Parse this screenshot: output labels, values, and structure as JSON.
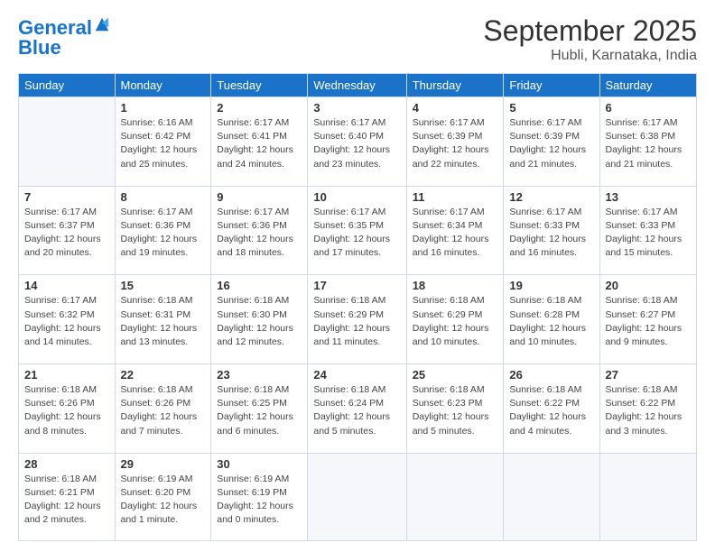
{
  "header": {
    "logo_line1": "General",
    "logo_line2": "Blue",
    "month": "September 2025",
    "location": "Hubli, Karnataka, India"
  },
  "weekdays": [
    "Sunday",
    "Monday",
    "Tuesday",
    "Wednesday",
    "Thursday",
    "Friday",
    "Saturday"
  ],
  "weeks": [
    [
      {
        "day": "",
        "info": ""
      },
      {
        "day": "1",
        "info": "Sunrise: 6:16 AM\nSunset: 6:42 PM\nDaylight: 12 hours\nand 25 minutes."
      },
      {
        "day": "2",
        "info": "Sunrise: 6:17 AM\nSunset: 6:41 PM\nDaylight: 12 hours\nand 24 minutes."
      },
      {
        "day": "3",
        "info": "Sunrise: 6:17 AM\nSunset: 6:40 PM\nDaylight: 12 hours\nand 23 minutes."
      },
      {
        "day": "4",
        "info": "Sunrise: 6:17 AM\nSunset: 6:39 PM\nDaylight: 12 hours\nand 22 minutes."
      },
      {
        "day": "5",
        "info": "Sunrise: 6:17 AM\nSunset: 6:39 PM\nDaylight: 12 hours\nand 21 minutes."
      },
      {
        "day": "6",
        "info": "Sunrise: 6:17 AM\nSunset: 6:38 PM\nDaylight: 12 hours\nand 21 minutes."
      }
    ],
    [
      {
        "day": "7",
        "info": "Sunrise: 6:17 AM\nSunset: 6:37 PM\nDaylight: 12 hours\nand 20 minutes."
      },
      {
        "day": "8",
        "info": "Sunrise: 6:17 AM\nSunset: 6:36 PM\nDaylight: 12 hours\nand 19 minutes."
      },
      {
        "day": "9",
        "info": "Sunrise: 6:17 AM\nSunset: 6:36 PM\nDaylight: 12 hours\nand 18 minutes."
      },
      {
        "day": "10",
        "info": "Sunrise: 6:17 AM\nSunset: 6:35 PM\nDaylight: 12 hours\nand 17 minutes."
      },
      {
        "day": "11",
        "info": "Sunrise: 6:17 AM\nSunset: 6:34 PM\nDaylight: 12 hours\nand 16 minutes."
      },
      {
        "day": "12",
        "info": "Sunrise: 6:17 AM\nSunset: 6:33 PM\nDaylight: 12 hours\nand 16 minutes."
      },
      {
        "day": "13",
        "info": "Sunrise: 6:17 AM\nSunset: 6:33 PM\nDaylight: 12 hours\nand 15 minutes."
      }
    ],
    [
      {
        "day": "14",
        "info": "Sunrise: 6:17 AM\nSunset: 6:32 PM\nDaylight: 12 hours\nand 14 minutes."
      },
      {
        "day": "15",
        "info": "Sunrise: 6:18 AM\nSunset: 6:31 PM\nDaylight: 12 hours\nand 13 minutes."
      },
      {
        "day": "16",
        "info": "Sunrise: 6:18 AM\nSunset: 6:30 PM\nDaylight: 12 hours\nand 12 minutes."
      },
      {
        "day": "17",
        "info": "Sunrise: 6:18 AM\nSunset: 6:29 PM\nDaylight: 12 hours\nand 11 minutes."
      },
      {
        "day": "18",
        "info": "Sunrise: 6:18 AM\nSunset: 6:29 PM\nDaylight: 12 hours\nand 10 minutes."
      },
      {
        "day": "19",
        "info": "Sunrise: 6:18 AM\nSunset: 6:28 PM\nDaylight: 12 hours\nand 10 minutes."
      },
      {
        "day": "20",
        "info": "Sunrise: 6:18 AM\nSunset: 6:27 PM\nDaylight: 12 hours\nand 9 minutes."
      }
    ],
    [
      {
        "day": "21",
        "info": "Sunrise: 6:18 AM\nSunset: 6:26 PM\nDaylight: 12 hours\nand 8 minutes."
      },
      {
        "day": "22",
        "info": "Sunrise: 6:18 AM\nSunset: 6:26 PM\nDaylight: 12 hours\nand 7 minutes."
      },
      {
        "day": "23",
        "info": "Sunrise: 6:18 AM\nSunset: 6:25 PM\nDaylight: 12 hours\nand 6 minutes."
      },
      {
        "day": "24",
        "info": "Sunrise: 6:18 AM\nSunset: 6:24 PM\nDaylight: 12 hours\nand 5 minutes."
      },
      {
        "day": "25",
        "info": "Sunrise: 6:18 AM\nSunset: 6:23 PM\nDaylight: 12 hours\nand 5 minutes."
      },
      {
        "day": "26",
        "info": "Sunrise: 6:18 AM\nSunset: 6:22 PM\nDaylight: 12 hours\nand 4 minutes."
      },
      {
        "day": "27",
        "info": "Sunrise: 6:18 AM\nSunset: 6:22 PM\nDaylight: 12 hours\nand 3 minutes."
      }
    ],
    [
      {
        "day": "28",
        "info": "Sunrise: 6:18 AM\nSunset: 6:21 PM\nDaylight: 12 hours\nand 2 minutes."
      },
      {
        "day": "29",
        "info": "Sunrise: 6:19 AM\nSunset: 6:20 PM\nDaylight: 12 hours\nand 1 minute."
      },
      {
        "day": "30",
        "info": "Sunrise: 6:19 AM\nSunset: 6:19 PM\nDaylight: 12 hours\nand 0 minutes."
      },
      {
        "day": "",
        "info": ""
      },
      {
        "day": "",
        "info": ""
      },
      {
        "day": "",
        "info": ""
      },
      {
        "day": "",
        "info": ""
      }
    ]
  ]
}
